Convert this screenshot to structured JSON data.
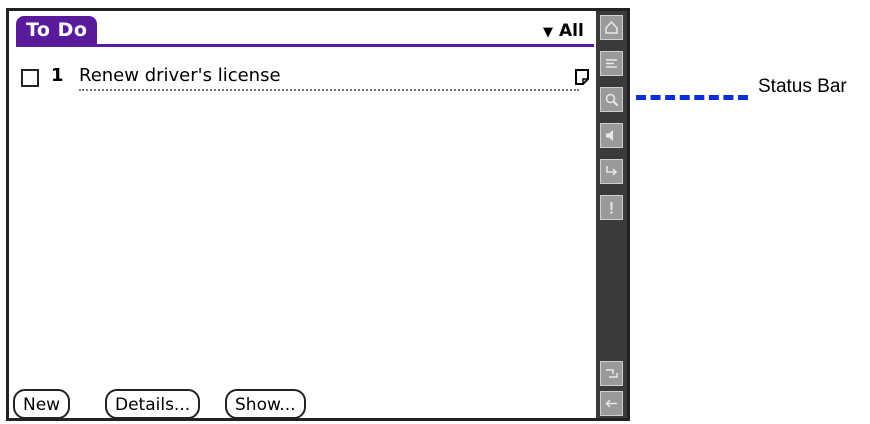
{
  "app": {
    "title": "To Do"
  },
  "category": {
    "selected": "All"
  },
  "todos": [
    {
      "priority": "1",
      "text": "Renew driver's license",
      "completed": false,
      "has_note": true
    }
  ],
  "buttons": {
    "new": "New",
    "details": "Details...",
    "show": "Show..."
  },
  "status_bar": {
    "icons": [
      "home-icon",
      "menu-icon",
      "find-icon",
      "speaker-icon",
      "beam-icon",
      "alert-icon",
      "keyboard-icon",
      "back-icon"
    ]
  },
  "callout": {
    "label": "Status Bar"
  },
  "colors": {
    "accent": "#5a1a9c",
    "callout": "#0a2fd6",
    "status_bar": "#3a3a3a"
  }
}
